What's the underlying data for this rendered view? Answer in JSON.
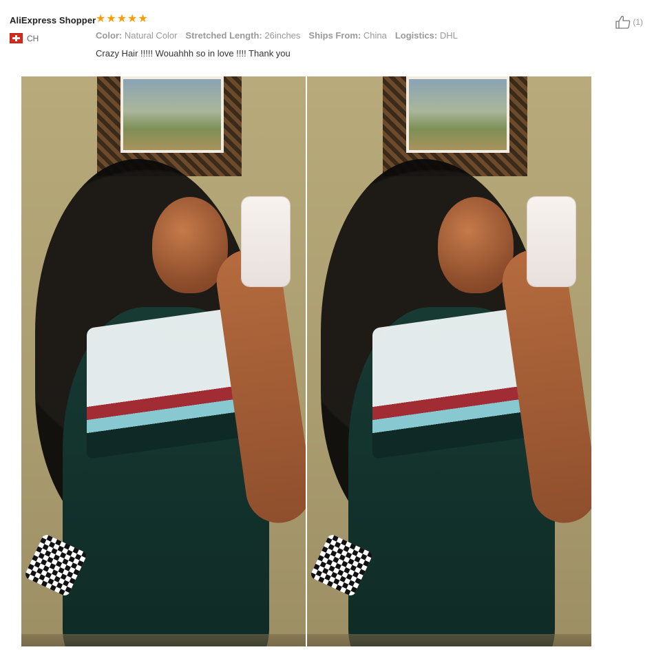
{
  "review": {
    "reviewer_name": "AliExpress Shopper",
    "country_code": "CH",
    "rating": 5,
    "stars_count": 5,
    "helpful": {
      "count_label": "(1)"
    },
    "attributes": [
      {
        "key": "Color:",
        "value": "Natural Color"
      },
      {
        "key": "Stretched Length:",
        "value": "26inches"
      },
      {
        "key": "Ships From:",
        "value": "China"
      },
      {
        "key": "Logistics:",
        "value": "DHL"
      }
    ],
    "feedback_text": "Crazy Hair !!!!! Wouahhh so in love !!!! Thank you"
  },
  "icons": {
    "star": "star-icon",
    "thumbs_up": "thumbs-up-icon",
    "flag": "switzerland-flag-icon"
  },
  "colors": {
    "star": "#ff9a00",
    "muted_text": "#999999",
    "primary_text": "#222222"
  }
}
